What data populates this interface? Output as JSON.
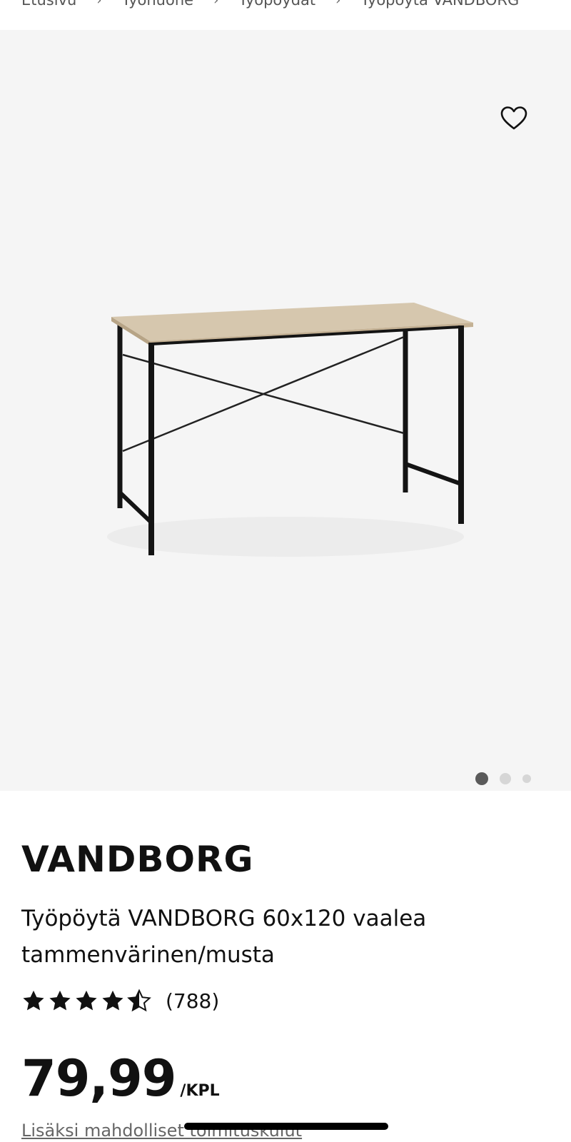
{
  "breadcrumb": {
    "items": [
      "Etusivu",
      "Työhuone",
      "Työpöydät",
      "Työpöytä VANDBORG"
    ],
    "separator": "›"
  },
  "product": {
    "brand": "VANDBORG",
    "description": "Työpöytä VANDBORG 60x120 vaalea tammenvärinen/musta",
    "rating": 4.5,
    "review_count": "(788)",
    "price": "79,99",
    "price_unit": "/KPL",
    "shipping_note": "Lisäksi mahdolliset toimituskulut"
  },
  "gallery": {
    "image_count": 3,
    "active_index": 0
  },
  "icons": {
    "favorite": "heart-outline-icon",
    "star": "star-icon"
  },
  "colors": {
    "text": "#111111",
    "hero_background": "#f5f5f5",
    "dot_active": "#5a5a5a",
    "dot_inactive": "#d6d6d6"
  }
}
